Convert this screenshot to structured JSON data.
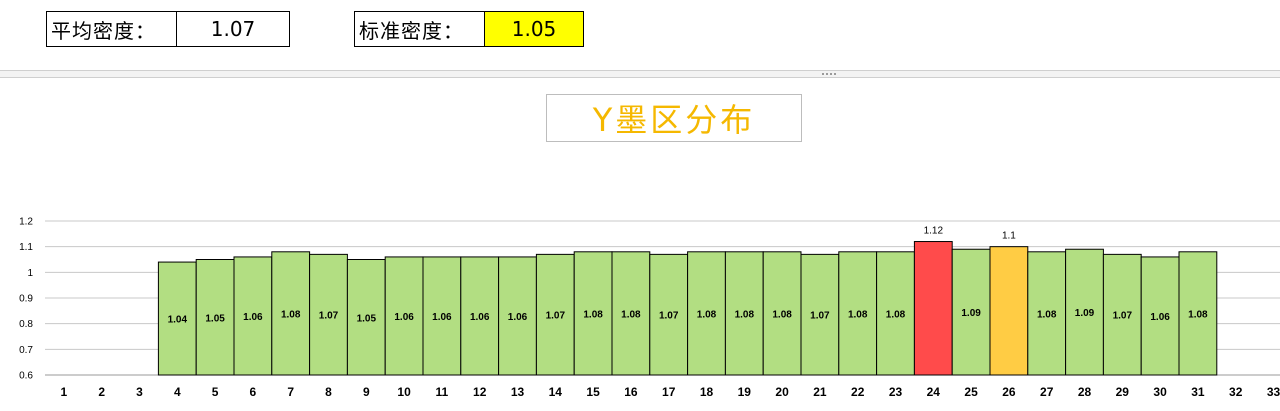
{
  "header": {
    "avg_label": "平均密度：",
    "avg_value": "1.07",
    "std_label": "标准密度：",
    "std_value": "1.05",
    "std_value_bg": "#FFFF00"
  },
  "chart_data": {
    "type": "bar",
    "title": "Y墨区分布",
    "title_color": "#F5B800",
    "ylim": [
      0.6,
      1.2
    ],
    "yticks": [
      0.6,
      0.7,
      0.8,
      0.9,
      1,
      1.1,
      1.2
    ],
    "ytick_labels": [
      "0.6",
      "0.7",
      "0.8",
      "0.9",
      "1",
      "1.1",
      "1.2"
    ],
    "grid": true,
    "categories": [
      "1",
      "2",
      "3",
      "4",
      "5",
      "6",
      "7",
      "8",
      "9",
      "10",
      "11",
      "12",
      "13",
      "14",
      "15",
      "16",
      "17",
      "18",
      "19",
      "20",
      "21",
      "22",
      "23",
      "24",
      "25",
      "26",
      "27",
      "28",
      "29",
      "30",
      "31",
      "32",
      "33"
    ],
    "values": [
      null,
      null,
      null,
      1.04,
      1.05,
      1.06,
      1.08,
      1.07,
      1.05,
      1.06,
      1.06,
      1.06,
      1.06,
      1.07,
      1.08,
      1.08,
      1.07,
      1.08,
      1.08,
      1.08,
      1.07,
      1.08,
      1.08,
      1.12,
      1.09,
      1.1,
      1.08,
      1.09,
      1.07,
      1.06,
      1.08,
      null,
      null
    ],
    "labels": [
      "",
      "",
      "",
      "1.04",
      "1.05",
      "1.06",
      "1.08",
      "1.07",
      "1.05",
      "1.06",
      "1.06",
      "1.06",
      "1.06",
      "1.07",
      "1.08",
      "1.08",
      "1.07",
      "1.08",
      "1.08",
      "1.08",
      "1.07",
      "1.08",
      "1.08",
      "1.12",
      "1.09",
      "1.1",
      "1.08",
      "1.09",
      "1.07",
      "1.06",
      "1.08",
      "",
      ""
    ],
    "colors": {
      "normal": "#B2DE82",
      "high": "#FF4B4B",
      "warning": "#FFCC44"
    },
    "highlight": {
      "24": "high",
      "26": "warning"
    },
    "label_outside": [
      "24",
      "26"
    ]
  }
}
